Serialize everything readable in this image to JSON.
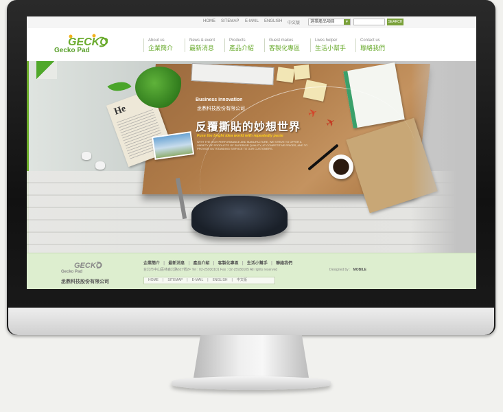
{
  "topbar": {
    "links": [
      "HOME",
      "SITEMAP",
      "E-MAIL",
      "ENGLISH",
      "中文版"
    ],
    "select_value": "選擇產品項目",
    "search_label": "SEARCH"
  },
  "brand": {
    "logo_word": "GECKO",
    "name": "Gecko Pad"
  },
  "nav": [
    {
      "en": "About us",
      "zh": "企業簡介"
    },
    {
      "en": "News & event",
      "zh": "最新消息"
    },
    {
      "en": "Products",
      "zh": "產品介紹"
    },
    {
      "en": "Guest makes",
      "zh": "客製化專區"
    },
    {
      "en": "Lives helper",
      "zh": "生活小幫手"
    },
    {
      "en": "Contact us",
      "zh": "聯絡我們"
    }
  ],
  "hero": {
    "kicker": "Business innovation",
    "company": "丞鼎科技股份有限公司",
    "headline": "反覆撕貼的妙想世界",
    "tagline": "Fuse the bright idea world with repeatedly paste",
    "paragraph": "WITH THE HIGH PERFORMANCE AND MANUFACTURE, WE STRIVE TO OFFER A VARIETY OF PRODUCTS OF SUPERIOR QUALITY, AT COMPETITIVE PRICES, AND TO PROVIDE OUTSTANDING SERVICE TO OUR CUSTOMERS."
  },
  "footer": {
    "logo_word": "GECKO",
    "logo_name": "Gecko Pad",
    "company": "丞鼎科技股份有限公司",
    "links": [
      "企業簡介",
      "最新消息",
      "產品介紹",
      "客製化專區",
      "生活小幫手",
      "聯絡我們"
    ],
    "address": "台北市中山區林森北路627號2F    Tel : 02-25930101    Fax : 02-25930105    All rights reserved",
    "bottom_links": [
      "HOME",
      "SITEMAP",
      "E-MAIL",
      "ENGLISH",
      "中文版"
    ],
    "designed_label": "Designed by :",
    "designer": "MOBILE"
  },
  "colors": {
    "brand_green": "#6aab2e",
    "footer_bg": "#ddeecf",
    "accent_yellow": "#ffd21a"
  }
}
